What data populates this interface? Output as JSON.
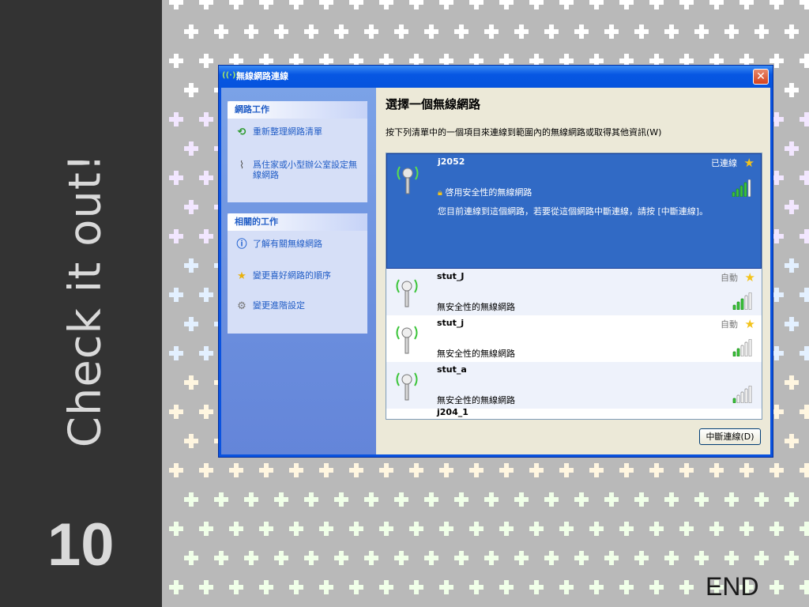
{
  "slide": {
    "vertical_title": "Check it out!",
    "number": "10",
    "end_label": "END",
    "colors": {
      "left_band": "#333333",
      "background": "#b9b9b9"
    }
  },
  "window": {
    "title": "無線網路連線",
    "close_glyph": "✕",
    "taskpane": {
      "network_tasks": {
        "heading": "網路工作",
        "items": [
          {
            "label": "重新整理網路清單",
            "icon": "refresh-icon"
          },
          {
            "label": "爲住家或小型辦公室設定無線網路",
            "icon": "wizard-icon"
          }
        ]
      },
      "related_tasks": {
        "heading": "相關的工作",
        "items": [
          {
            "label": "了解有關無線網路",
            "icon": "info-icon"
          },
          {
            "label": "變更喜好網路的順序",
            "icon": "star-icon"
          },
          {
            "label": "變更進階設定",
            "icon": "settings-icon"
          }
        ]
      }
    },
    "main": {
      "heading": "選擇一個無線網路",
      "description": "按下列清單中的一個項目來連線到範圍內的無線網路或取得其他資訊(W)",
      "networks": [
        {
          "name": "j2052",
          "status": "已連線",
          "security": "啓用安全性的無線網路",
          "message": "您目前連線到這個網路，若要從這個網路中斷連線，請按 [中斷連線]。",
          "signal": 0.8,
          "selected": true
        },
        {
          "name": "stut_J",
          "status": "自動",
          "security": "無安全性的無線網路",
          "signal": 0.6
        },
        {
          "name": "stut_j",
          "status": "自動",
          "security": "無安全性的無線網路",
          "signal": 0.4
        },
        {
          "name": "stut_a",
          "status": "",
          "security": "無安全性的無線網路",
          "signal": 0.2
        },
        {
          "name": "j204_1",
          "status": "",
          "security": "",
          "signal": 0
        }
      ],
      "disconnect_button": "中斷連線(D)"
    }
  }
}
